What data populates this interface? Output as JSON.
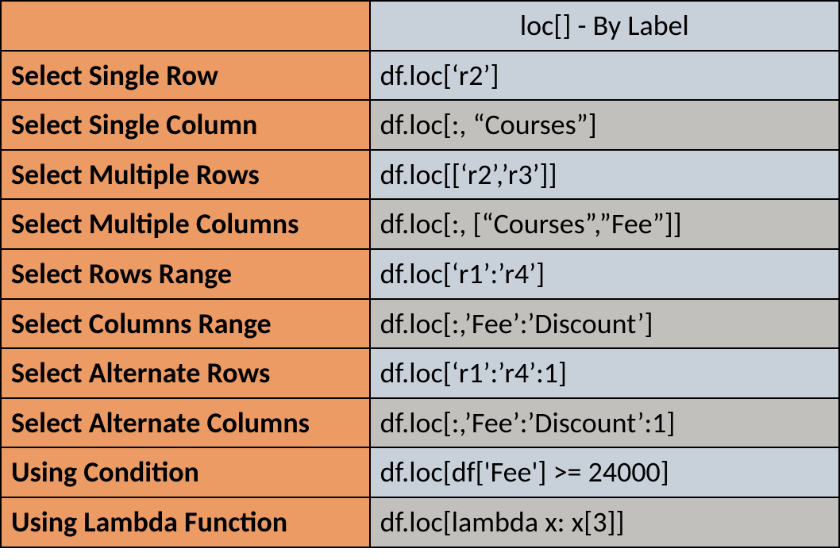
{
  "header": {
    "blank": "",
    "main": "loc[] - By Label"
  },
  "rows": [
    {
      "label": "Select Single Row",
      "code": "df.loc[‘r2’]"
    },
    {
      "label": "Select Single Column",
      "code": "df.loc[:, “Courses”]"
    },
    {
      "label": "Select Multiple Rows",
      "code": "df.loc[[‘r2’,’r3’]]"
    },
    {
      "label": "Select Multiple Columns",
      "code": "df.loc[:, [“Courses”,”Fee”]]"
    },
    {
      "label": "Select Rows Range",
      "code": "df.loc[‘r1’:’r4’]"
    },
    {
      "label": "Select Columns Range",
      "code": "df.loc[:,’Fee’:’Discount’]"
    },
    {
      "label": "Select Alternate Rows",
      "code": "df.loc[‘r1’:’r4’:1]"
    },
    {
      "label": "Select Alternate Columns",
      "code": "df.loc[:,’Fee’:’Discount’:1]"
    },
    {
      "label": "Using Condition",
      "code": "df.loc[df['Fee'] >= 24000]"
    },
    {
      "label": "Using Lambda Function",
      "code": "df.loc[lambda x: x[3]]"
    }
  ]
}
